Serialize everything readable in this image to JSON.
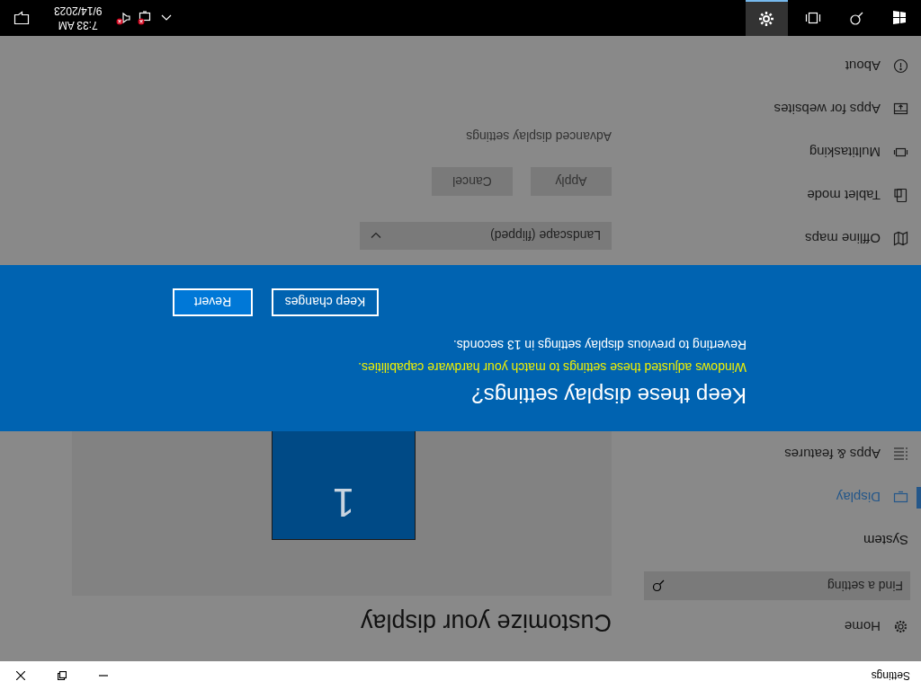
{
  "title_bar": {
    "title": "Settings"
  },
  "sidebar": {
    "home": "Home",
    "search": {
      "placeholder": "Find a setting"
    },
    "section": "System",
    "items": [
      {
        "kind": "display",
        "label": "Display",
        "selected": true
      },
      {
        "kind": "apps",
        "label": "Apps & features",
        "selected": false
      }
    ],
    "items_below": [
      {
        "kind": "maps",
        "label": "Offline maps",
        "selected": false
      },
      {
        "kind": "tablet",
        "label": "Tablet mode",
        "selected": false
      },
      {
        "kind": "multitasking",
        "label": "Multitasking",
        "selected": false
      },
      {
        "kind": "websites",
        "label": "Apps for websites",
        "selected": false
      },
      {
        "kind": "about",
        "label": "About",
        "selected": false
      }
    ]
  },
  "main": {
    "heading": "Customize your display",
    "monitor": "1",
    "orientation": "Landscape (flipped)",
    "buttons": [
      "Apply",
      "Cancel"
    ],
    "link": "Advanced display settings"
  },
  "dialog": {
    "title": "Keep these display settings?",
    "warning": "Windows adjusted these settings to match your hardware capabilities.",
    "message": "Reverting to previous display settings in 13 seconds.",
    "buttons": [
      "Keep changes",
      "Revert"
    ]
  },
  "taskbar": {
    "apps": [
      {
        "kind": "start",
        "selected": false
      },
      {
        "kind": "search",
        "selected": false
      },
      {
        "kind": "taskview",
        "selected": false
      },
      {
        "kind": "settings",
        "selected": true
      }
    ],
    "time": "7:33 AM",
    "date": "9/14/2023"
  }
}
